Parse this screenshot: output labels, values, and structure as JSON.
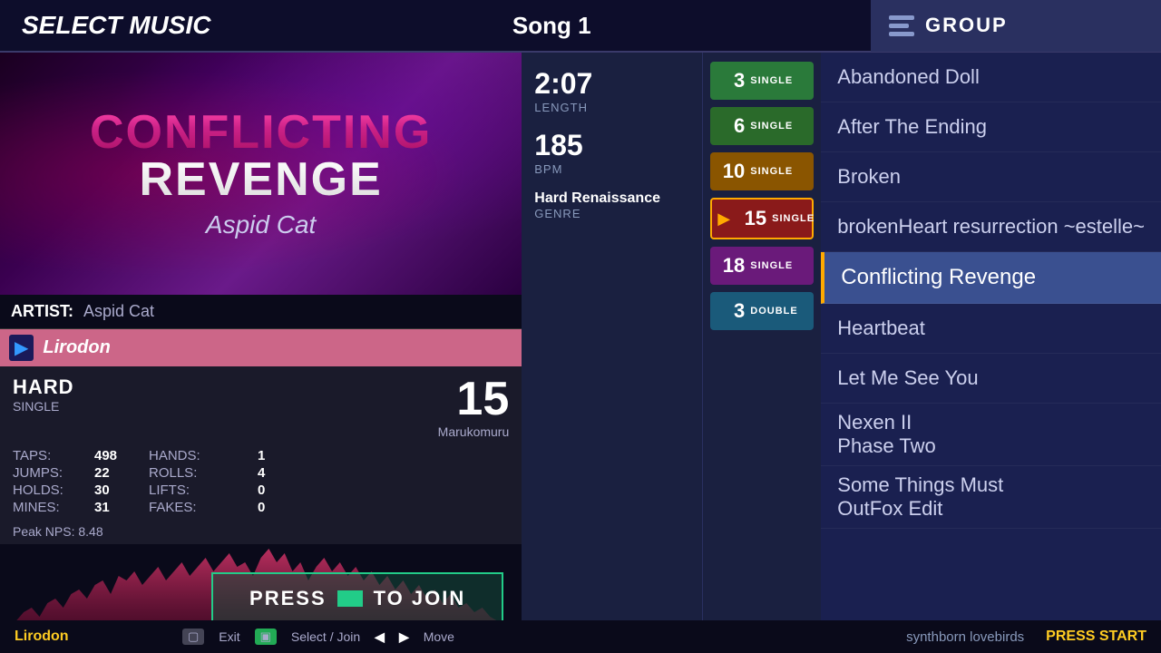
{
  "header": {
    "title": "SELECT MUSIC",
    "song_number": "Song 1",
    "group_label": "GROUP"
  },
  "banner": {
    "title_line1": "CONFLICTING",
    "title_line2": "REVENGE",
    "artist": "Aspid Cat"
  },
  "artist_row": {
    "label": "ARTIST:",
    "name": "Aspid Cat"
  },
  "player": {
    "name": "Lirodon"
  },
  "difficulty": {
    "name": "HARD",
    "type": "SINGLE",
    "number": "15",
    "charter": "Marukomuru"
  },
  "stats": {
    "taps_label": "TAPS:",
    "taps": "498",
    "hands_label": "HANDS:",
    "hands": "1",
    "jumps_label": "JUMPS:",
    "jumps": "22",
    "rolls_label": "ROLLS:",
    "rolls": "4",
    "holds_label": "HOLDS:",
    "holds": "30",
    "lifts_label": "LIFTS:",
    "lifts": "0",
    "mines_label": "MINES:",
    "mines": "31",
    "fakes_label": "FAKES:",
    "fakes": "0",
    "peak_nps": "Peak NPS: 8.48"
  },
  "song_info": {
    "length": "2:07",
    "length_label": "LENGTH",
    "bpm": "185",
    "bpm_label": "BPM",
    "genre": "Hard Renaissance",
    "genre_label": "GENRE"
  },
  "difficulty_buttons": [
    {
      "number": "3",
      "mode": "SINGLE",
      "class": "easy"
    },
    {
      "number": "6",
      "mode": "SINGLE",
      "class": "medium"
    },
    {
      "number": "10",
      "mode": "SINGLE",
      "class": "hard-orange"
    },
    {
      "number": "15",
      "mode": "SINGLE",
      "class": "hard-red",
      "active": true
    },
    {
      "number": "18",
      "mode": "SINGLE",
      "class": "expert"
    },
    {
      "number": "3",
      "mode": "DOUBLE",
      "class": "double-easy"
    }
  ],
  "song_list": [
    {
      "title": "Abandoned Doll",
      "active": false
    },
    {
      "title": "After The Ending",
      "active": false
    },
    {
      "title": "Broken",
      "active": false
    },
    {
      "title": "brokenHeart resurrection ~estelle~",
      "active": false
    },
    {
      "title": "Conflicting Revenge",
      "active": true
    },
    {
      "title": "Heartbeat",
      "active": false
    },
    {
      "title": "Let Me See You",
      "active": false
    },
    {
      "title": "Nexen II",
      "subtitle": "Phase Two",
      "active": false
    },
    {
      "title": "Some Things Must",
      "subtitle": "OutFox Edit",
      "active": false
    }
  ],
  "press_join": {
    "label_before": "PRESS",
    "label_after": "TO JOIN"
  },
  "bottom": {
    "player": "Lirodon",
    "exit_label": "Exit",
    "select_label": "Select / Join",
    "move_label": "Move",
    "press_start": "PRESS START"
  },
  "bottom_song": "synthborn lovebirds"
}
